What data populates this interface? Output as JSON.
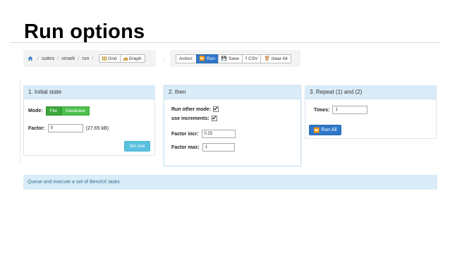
{
  "slide": {
    "title": "Run options"
  },
  "breadcrumb": {
    "items": [
      "suites",
      "xmark",
      "run"
    ],
    "view_buttons": [
      {
        "label": "Grid",
        "icon": "grid-icon"
      },
      {
        "label": "Graph",
        "icon": "graph-icon"
      }
    ]
  },
  "actions": {
    "colon": ":",
    "action_label": "Action:",
    "run_label": "Run",
    "save_label": "Save",
    "csv_label": "CSV",
    "clear_all_label": "clear All"
  },
  "panel1": {
    "header": "1. Initial state",
    "mode_label": "Mode:",
    "mode_file": "File",
    "mode_database": "Database",
    "factor_label": "Factor:",
    "factor_value": "0",
    "factor_size": "(27.65 kB)",
    "set_now": "Set now"
  },
  "panel2": {
    "header": "2. then",
    "run_other_mode_label": "Run other mode:",
    "use_increments_label": "use increments:",
    "factor_incr_label": "Factor incr:",
    "factor_incr_value": "0.25",
    "factor_max_label": "Factor max:",
    "factor_max_value": "1"
  },
  "panel3": {
    "header": "3. Repeat (1) and (2)",
    "times_label": "Times:",
    "times_value": "1",
    "run_all": "Run All"
  },
  "info": {
    "text": "Queue and execute a set of BenchX tasks"
  },
  "colors": {
    "primary": "#2f77c8",
    "success": "#3aa83a",
    "info": "#5bc0de",
    "panel_head": "#d9ecf7"
  }
}
